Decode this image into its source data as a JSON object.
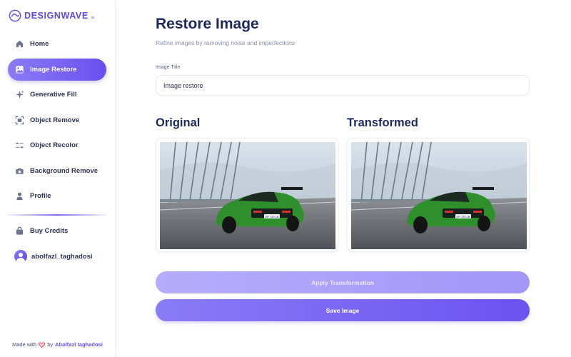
{
  "brand": {
    "name": "DESIGNWAVE",
    "suffix": "ai",
    "accent": "#6a4ff0"
  },
  "sidebar": {
    "items": [
      {
        "label": "Home",
        "icon": "home-icon",
        "active": false
      },
      {
        "label": "Image Restore",
        "icon": "image-icon",
        "active": true
      },
      {
        "label": "Generative Fill",
        "icon": "sparkle-icon",
        "active": false
      },
      {
        "label": "Object Remove",
        "icon": "scan-icon",
        "active": false
      },
      {
        "label": "Object Recolor",
        "icon": "filter-icon",
        "active": false
      },
      {
        "label": "Background Remove",
        "icon": "camera-icon",
        "active": false
      },
      {
        "label": "Profile",
        "icon": "user-icon",
        "active": false
      }
    ],
    "secondary": [
      {
        "label": "Buy Credits",
        "icon": "bag-icon"
      }
    ],
    "user": {
      "name": "abolfazl_taghadosi"
    },
    "footer": {
      "made_with": "Made with",
      "by": "by",
      "author": "Abolfazl taghadosi"
    }
  },
  "main": {
    "title": "Restore Image",
    "subtitle": "Refine images by removing noise and imperfections",
    "field": {
      "label": "Image Title",
      "value": "Image restore"
    },
    "original_heading": "Original",
    "transformed_heading": "Transformed",
    "apply_label": "Apply Transformation",
    "save_label": "Save Image",
    "plate_text": "EP 720 LB"
  }
}
